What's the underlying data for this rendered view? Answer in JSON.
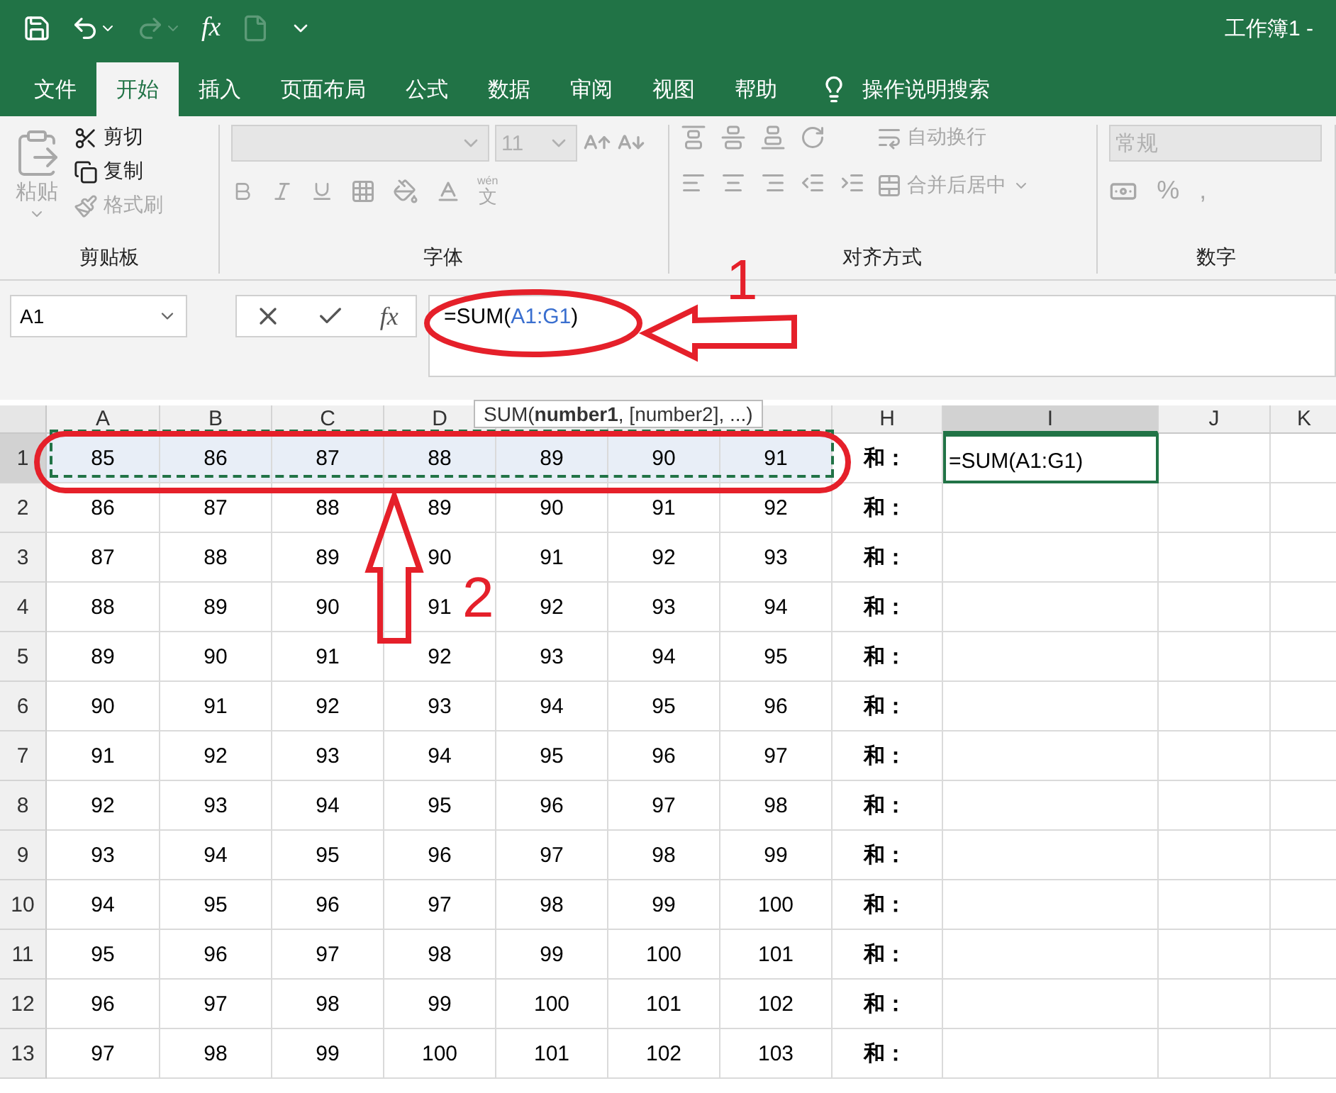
{
  "window": {
    "title": "工作簿1 -"
  },
  "quick_access": {
    "formula_glyph": "fx",
    "redo_disabled": true,
    "new_disabled": true
  },
  "tabs": [
    {
      "label": "文件",
      "selected": false
    },
    {
      "label": "开始",
      "selected": true
    },
    {
      "label": "插入",
      "selected": false
    },
    {
      "label": "页面布局",
      "selected": false
    },
    {
      "label": "公式",
      "selected": false
    },
    {
      "label": "数据",
      "selected": false
    },
    {
      "label": "审阅",
      "selected": false
    },
    {
      "label": "视图",
      "selected": false
    },
    {
      "label": "帮助",
      "selected": false
    }
  ],
  "tell_me": {
    "label": "操作说明搜索"
  },
  "ribbon": {
    "clipboard": {
      "title": "剪贴板",
      "paste": {
        "label": "粘贴",
        "disabled": true
      },
      "items": [
        {
          "label": "剪切",
          "disabled": false
        },
        {
          "label": "复制",
          "disabled": false
        },
        {
          "label": "格式刷",
          "disabled": true
        }
      ]
    },
    "font": {
      "title": "字体",
      "size": "11",
      "phonetic_top": "wén",
      "phonetic_bottom": "文"
    },
    "alignment": {
      "title": "对齐方式",
      "wrap": {
        "label": "自动换行",
        "disabled": true
      },
      "merge": {
        "label": "合并后居中",
        "disabled": true
      }
    },
    "number": {
      "title": "数字",
      "format": "常规",
      "percent": "%",
      "comma": ","
    }
  },
  "name_box": {
    "value": "A1"
  },
  "formula_bar": {
    "fx": "fx",
    "prefix": "=SUM(",
    "ref": "A1:G1",
    "suffix": ")"
  },
  "tooltip": {
    "text": "SUM(**number1**, [number2], ...)"
  },
  "columns": [
    {
      "label": "A",
      "selected": false
    },
    {
      "label": "B",
      "selected": false
    },
    {
      "label": "C",
      "selected": false
    },
    {
      "label": "D",
      "selected": false
    },
    {
      "selected": false
    },
    {
      "selected": false
    },
    {
      "selected": false
    },
    {
      "label": "H",
      "selected": false
    },
    {
      "label": "I",
      "selected": true
    },
    {
      "label": "J",
      "selected": false
    },
    {
      "label": "K",
      "selected": false
    }
  ],
  "rows": [
    {
      "header": "1",
      "in_range": true,
      "active": true,
      "cells": [
        "85",
        "86",
        "87",
        "88",
        "89",
        "90",
        "91",
        "和：",
        "=SUM(A1:G1)"
      ]
    },
    {
      "header": "2",
      "in_range": false,
      "cells": [
        "86",
        "87",
        "88",
        "89",
        "90",
        "91",
        "92",
        "和："
      ]
    },
    {
      "header": "3",
      "in_range": false,
      "cells": [
        "87",
        "88",
        "89",
        "90",
        "91",
        "92",
        "93",
        "和："
      ]
    },
    {
      "header": "4",
      "in_range": false,
      "cells": [
        "88",
        "89",
        "90",
        "91",
        "92",
        "93",
        "94",
        "和："
      ]
    },
    {
      "header": "5",
      "in_range": false,
      "cells": [
        "89",
        "90",
        "91",
        "92",
        "93",
        "94",
        "95",
        "和："
      ]
    },
    {
      "header": "6",
      "in_range": false,
      "cells": [
        "90",
        "91",
        "92",
        "93",
        "94",
        "95",
        "96",
        "和："
      ]
    },
    {
      "header": "7",
      "in_range": false,
      "cells": [
        "91",
        "92",
        "93",
        "94",
        "95",
        "96",
        "97",
        "和："
      ]
    },
    {
      "header": "8",
      "in_range": false,
      "cells": [
        "92",
        "93",
        "94",
        "95",
        "96",
        "97",
        "98",
        "和："
      ]
    },
    {
      "header": "9",
      "in_range": false,
      "cells": [
        "93",
        "94",
        "95",
        "96",
        "97",
        "98",
        "99",
        "和："
      ]
    },
    {
      "header": "10",
      "in_range": false,
      "cells": [
        "94",
        "95",
        "96",
        "97",
        "98",
        "99",
        "100",
        "和："
      ]
    },
    {
      "header": "11",
      "in_range": false,
      "cells": [
        "95",
        "96",
        "97",
        "98",
        "99",
        "100",
        "101",
        "和："
      ]
    },
    {
      "header": "12",
      "in_range": false,
      "cells": [
        "96",
        "97",
        "98",
        "99",
        "100",
        "101",
        "102",
        "和："
      ]
    },
    {
      "header": "13",
      "in_range": false,
      "cells": [
        "97",
        "98",
        "99",
        "100",
        "101",
        "102",
        "103",
        "和："
      ]
    }
  ],
  "annotations": [
    {
      "label": "1"
    },
    {
      "label": "2"
    }
  ]
}
